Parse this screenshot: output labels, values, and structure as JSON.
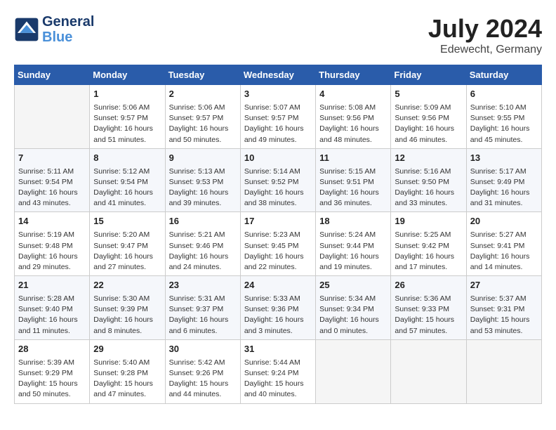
{
  "header": {
    "logo_line1": "General",
    "logo_line2": "Blue",
    "month_year": "July 2024",
    "location": "Edewecht, Germany"
  },
  "weekdays": [
    "Sunday",
    "Monday",
    "Tuesday",
    "Wednesday",
    "Thursday",
    "Friday",
    "Saturday"
  ],
  "weeks": [
    [
      {
        "day": "",
        "empty": true
      },
      {
        "day": "1",
        "sunrise": "5:06 AM",
        "sunset": "9:57 PM",
        "daylight": "16 hours and 51 minutes."
      },
      {
        "day": "2",
        "sunrise": "5:06 AM",
        "sunset": "9:57 PM",
        "daylight": "16 hours and 50 minutes."
      },
      {
        "day": "3",
        "sunrise": "5:07 AM",
        "sunset": "9:57 PM",
        "daylight": "16 hours and 49 minutes."
      },
      {
        "day": "4",
        "sunrise": "5:08 AM",
        "sunset": "9:56 PM",
        "daylight": "16 hours and 48 minutes."
      },
      {
        "day": "5",
        "sunrise": "5:09 AM",
        "sunset": "9:56 PM",
        "daylight": "16 hours and 46 minutes."
      },
      {
        "day": "6",
        "sunrise": "5:10 AM",
        "sunset": "9:55 PM",
        "daylight": "16 hours and 45 minutes."
      }
    ],
    [
      {
        "day": "7",
        "sunrise": "5:11 AM",
        "sunset": "9:54 PM",
        "daylight": "16 hours and 43 minutes."
      },
      {
        "day": "8",
        "sunrise": "5:12 AM",
        "sunset": "9:54 PM",
        "daylight": "16 hours and 41 minutes."
      },
      {
        "day": "9",
        "sunrise": "5:13 AM",
        "sunset": "9:53 PM",
        "daylight": "16 hours and 39 minutes."
      },
      {
        "day": "10",
        "sunrise": "5:14 AM",
        "sunset": "9:52 PM",
        "daylight": "16 hours and 38 minutes."
      },
      {
        "day": "11",
        "sunrise": "5:15 AM",
        "sunset": "9:51 PM",
        "daylight": "16 hours and 36 minutes."
      },
      {
        "day": "12",
        "sunrise": "5:16 AM",
        "sunset": "9:50 PM",
        "daylight": "16 hours and 33 minutes."
      },
      {
        "day": "13",
        "sunrise": "5:17 AM",
        "sunset": "9:49 PM",
        "daylight": "16 hours and 31 minutes."
      }
    ],
    [
      {
        "day": "14",
        "sunrise": "5:19 AM",
        "sunset": "9:48 PM",
        "daylight": "16 hours and 29 minutes."
      },
      {
        "day": "15",
        "sunrise": "5:20 AM",
        "sunset": "9:47 PM",
        "daylight": "16 hours and 27 minutes."
      },
      {
        "day": "16",
        "sunrise": "5:21 AM",
        "sunset": "9:46 PM",
        "daylight": "16 hours and 24 minutes."
      },
      {
        "day": "17",
        "sunrise": "5:23 AM",
        "sunset": "9:45 PM",
        "daylight": "16 hours and 22 minutes."
      },
      {
        "day": "18",
        "sunrise": "5:24 AM",
        "sunset": "9:44 PM",
        "daylight": "16 hours and 19 minutes."
      },
      {
        "day": "19",
        "sunrise": "5:25 AM",
        "sunset": "9:42 PM",
        "daylight": "16 hours and 17 minutes."
      },
      {
        "day": "20",
        "sunrise": "5:27 AM",
        "sunset": "9:41 PM",
        "daylight": "16 hours and 14 minutes."
      }
    ],
    [
      {
        "day": "21",
        "sunrise": "5:28 AM",
        "sunset": "9:40 PM",
        "daylight": "16 hours and 11 minutes."
      },
      {
        "day": "22",
        "sunrise": "5:30 AM",
        "sunset": "9:39 PM",
        "daylight": "16 hours and 8 minutes."
      },
      {
        "day": "23",
        "sunrise": "5:31 AM",
        "sunset": "9:37 PM",
        "daylight": "16 hours and 6 minutes."
      },
      {
        "day": "24",
        "sunrise": "5:33 AM",
        "sunset": "9:36 PM",
        "daylight": "16 hours and 3 minutes."
      },
      {
        "day": "25",
        "sunrise": "5:34 AM",
        "sunset": "9:34 PM",
        "daylight": "16 hours and 0 minutes."
      },
      {
        "day": "26",
        "sunrise": "5:36 AM",
        "sunset": "9:33 PM",
        "daylight": "15 hours and 57 minutes."
      },
      {
        "day": "27",
        "sunrise": "5:37 AM",
        "sunset": "9:31 PM",
        "daylight": "15 hours and 53 minutes."
      }
    ],
    [
      {
        "day": "28",
        "sunrise": "5:39 AM",
        "sunset": "9:29 PM",
        "daylight": "15 hours and 50 minutes."
      },
      {
        "day": "29",
        "sunrise": "5:40 AM",
        "sunset": "9:28 PM",
        "daylight": "15 hours and 47 minutes."
      },
      {
        "day": "30",
        "sunrise": "5:42 AM",
        "sunset": "9:26 PM",
        "daylight": "15 hours and 44 minutes."
      },
      {
        "day": "31",
        "sunrise": "5:44 AM",
        "sunset": "9:24 PM",
        "daylight": "15 hours and 40 minutes."
      },
      {
        "day": "",
        "empty": true
      },
      {
        "day": "",
        "empty": true
      },
      {
        "day": "",
        "empty": true
      }
    ]
  ],
  "labels": {
    "sunrise": "Sunrise:",
    "sunset": "Sunset:",
    "daylight": "Daylight:"
  }
}
